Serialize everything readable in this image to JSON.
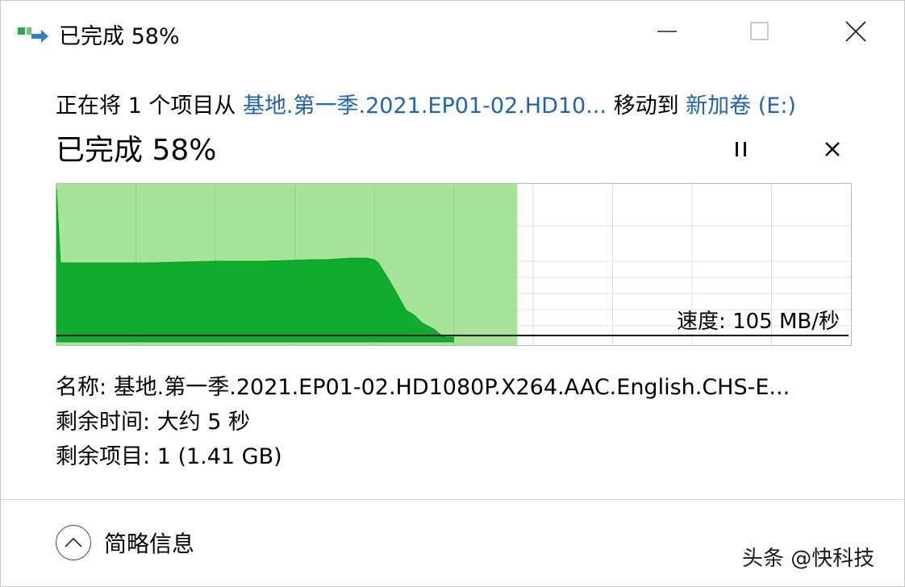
{
  "window": {
    "title": "已完成 58%",
    "icon": "copy-move-icon",
    "controls": {
      "minimize": "minimize-icon",
      "maximize": "maximize-icon",
      "close": "close-icon"
    }
  },
  "move": {
    "prefix": "正在将 1 个项目从 ",
    "source": "基地.第一季.2021.EP01-02.HD10...",
    "middle": " 移动到 ",
    "destination": "新加卷 (E:)"
  },
  "progress": {
    "label": "已完成 58%",
    "percent": 58,
    "pause_icon": "pause-icon",
    "cancel_icon": "cancel-icon"
  },
  "chart_data": {
    "type": "area",
    "title": "",
    "xlabel": "",
    "ylabel": "",
    "progress_fraction": 0.58,
    "speed_label": "速度: 105 MB/秒",
    "current_speed_level": 0.04,
    "grid": true,
    "series": [
      {
        "x": [
          0,
          0.005,
          0.12,
          0.2,
          0.26,
          0.32,
          0.34,
          0.37,
          0.39,
          0.4,
          0.405,
          0.42,
          0.44,
          0.45,
          0.46,
          0.475,
          0.485,
          0.49,
          0.5
        ],
        "values": [
          0.97,
          0.5,
          0.5,
          0.51,
          0.51,
          0.52,
          0.52,
          0.53,
          0.53,
          0.52,
          0.5,
          0.38,
          0.2,
          0.17,
          0.12,
          0.08,
          0.04,
          0.03,
          0.03
        ]
      }
    ]
  },
  "details": {
    "name_label": "名称: ",
    "name_value": "基地.第一季.2021.EP01-02.HD1080P.X264.AAC.English.CHS-E...",
    "time_label": "剩余时间: ",
    "time_value": "大约 5 秒",
    "items_label": "剩余项目: ",
    "items_value": "1 (1.41 GB)"
  },
  "footer": {
    "collapse_label": "简略信息",
    "collapse_icon": "chevron-up-icon"
  },
  "watermark": "头条 @快科技"
}
